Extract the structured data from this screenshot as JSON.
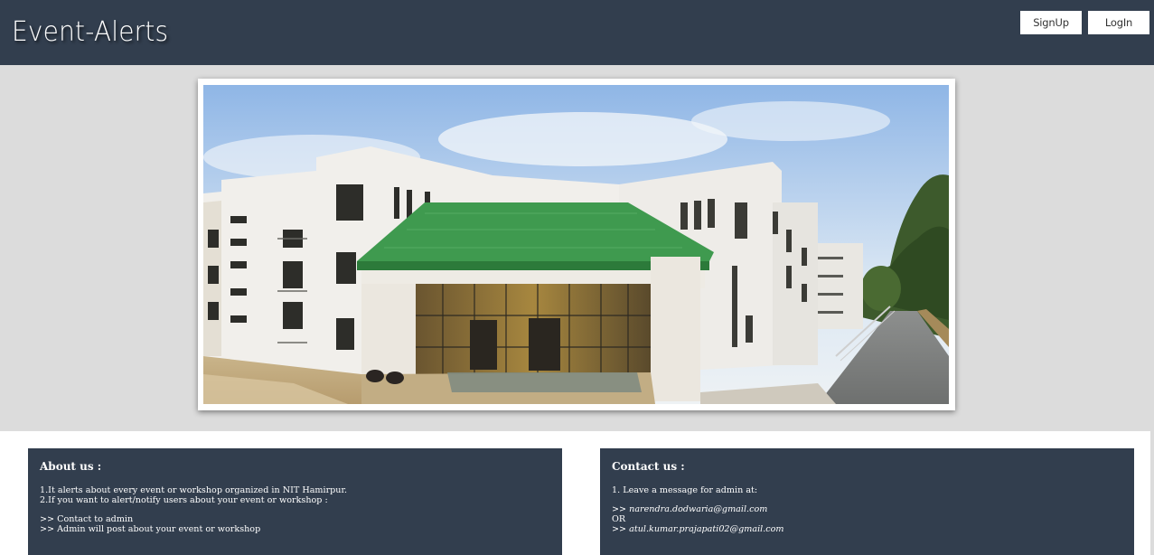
{
  "header": {
    "brand": "Event-Alerts",
    "signup_label": "SignUp",
    "login_label": "LogIn"
  },
  "hero": {
    "photo_description": "campus-building-photo"
  },
  "about": {
    "title": "About us :",
    "line1": "1.It alerts about every event or workshop organized in NIT Hamirpur.",
    "line2": "2.If you want to alert/notify users about your event or workshop :",
    "line3": ">> Contact to admin",
    "line4": ">> Admin will post about your event or workshop"
  },
  "contact": {
    "title": "Contact us :",
    "line1": "1. Leave a message for admin at:",
    "prefix1": ">> ",
    "email1": "narendra.dodwaria@gmail.com",
    "or": "OR",
    "prefix2": ">> ",
    "email2": "atul.kumar.prajapati02@gmail.com"
  },
  "colors": {
    "header_bg": "#323e4e",
    "hero_bg": "#dcdcdc",
    "panel_bg": "#323e4e"
  }
}
